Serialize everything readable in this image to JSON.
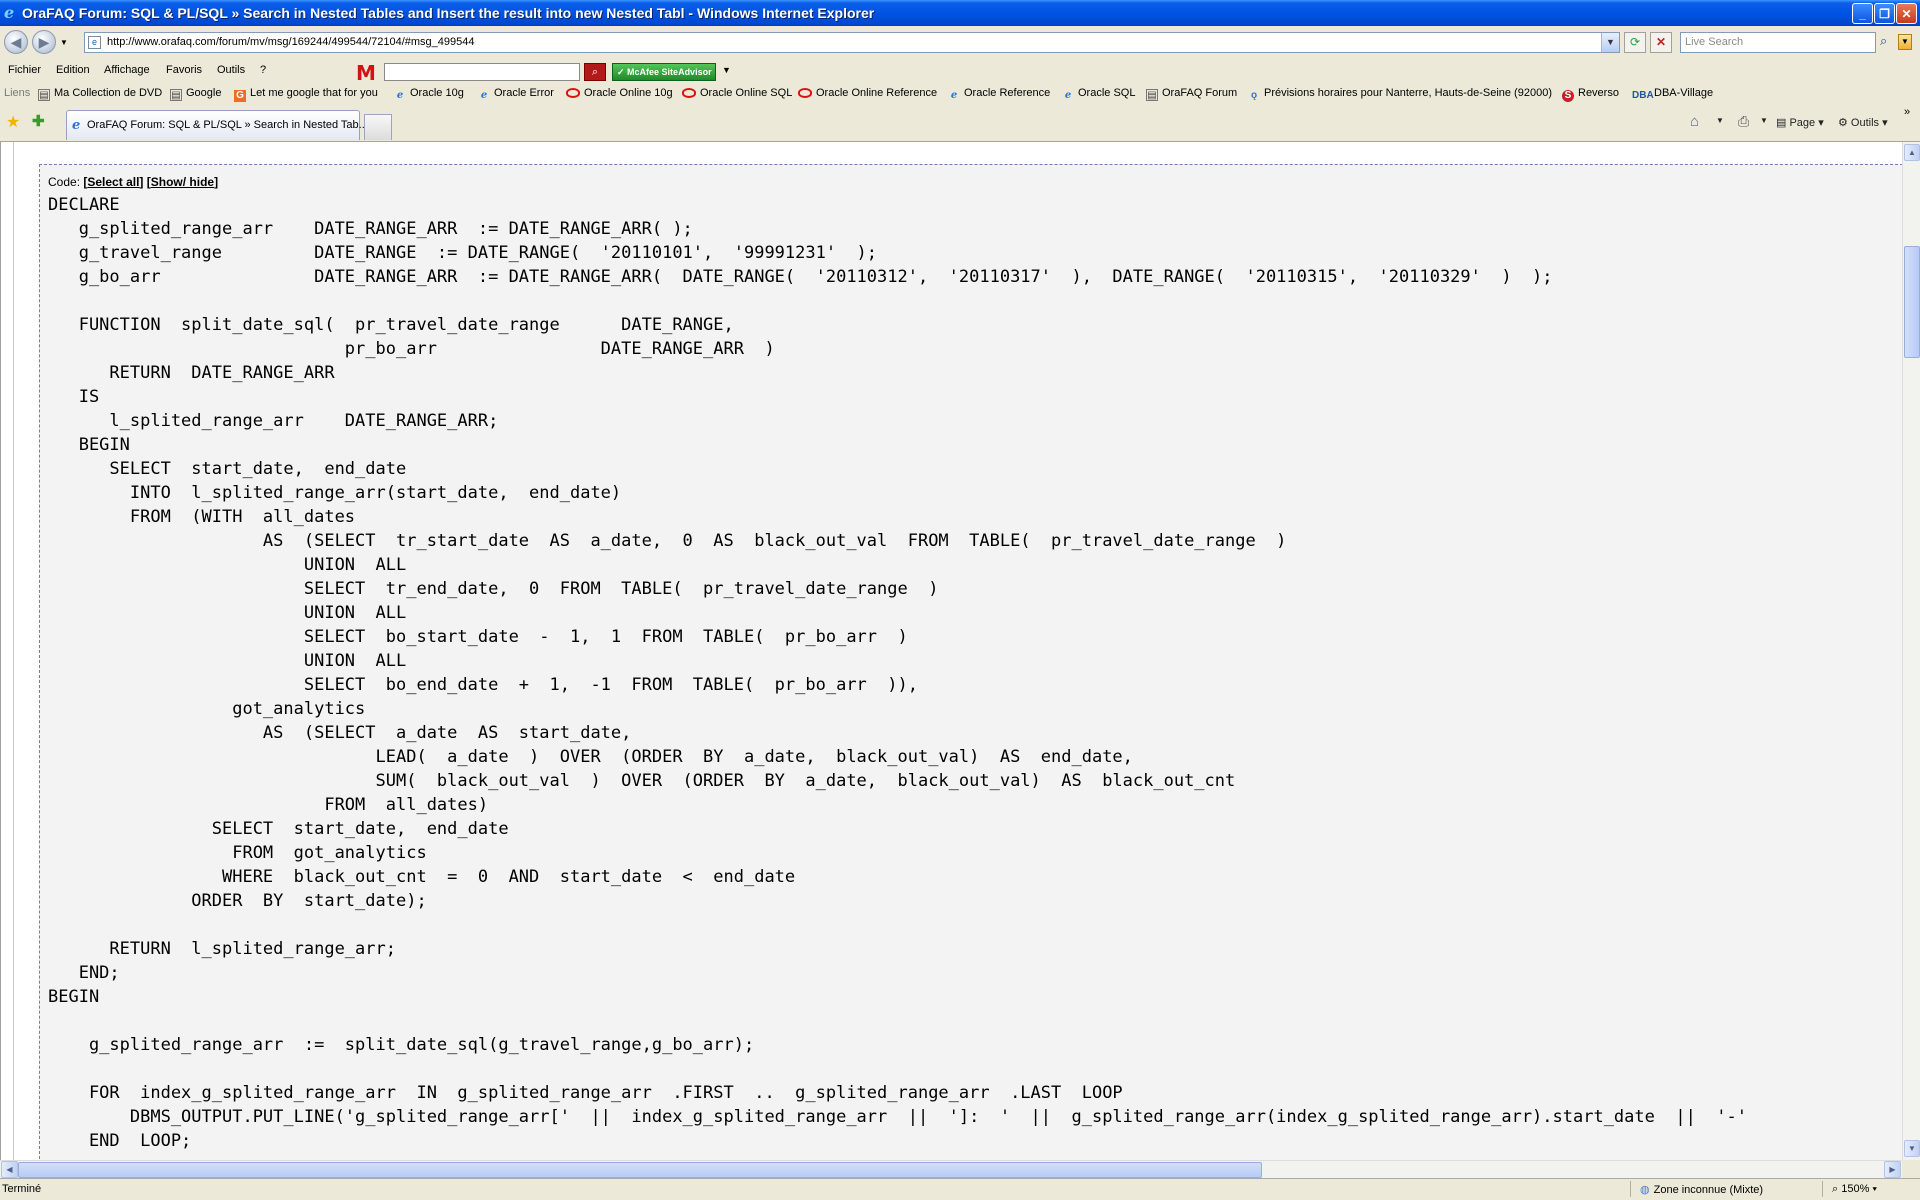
{
  "window": {
    "title": "OraFAQ Forum: SQL & PL/SQL » Search in Nested Tables and Insert the result into new Nested Tabl - Windows Internet Explorer",
    "minimize": "_",
    "restore": "❐",
    "close": "✕"
  },
  "address": {
    "url": "http://www.orafaq.com/forum/mv/msg/169244/499544/72104/#msg_499544",
    "search_placeholder": "Live Search"
  },
  "menu": {
    "items": [
      "Fichier",
      "Edition",
      "Affichage",
      "Favoris",
      "Outils",
      "?"
    ],
    "mcafee": "McAfee SiteAdvisor"
  },
  "links": {
    "label": "Liens",
    "items": [
      "Ma Collection de DVD",
      "Google",
      "Let me google that for you",
      "Oracle 10g",
      "Oracle Error",
      "Oracle Online 10g",
      "Oracle Online SQL",
      "Oracle Online Reference",
      "Oracle Reference",
      "Oracle SQL",
      "OraFAQ Forum",
      "Prévisions horaires pour Nanterre, Hauts-de-Seine (92000)",
      "Reverso",
      "DBA-Village"
    ]
  },
  "tabs": {
    "active_label": "OraFAQ Forum: SQL & PL/SQL » Search in Nested Tab...",
    "page_cmd": "Page",
    "tools_cmd": "Outils"
  },
  "code": {
    "label": "Code:",
    "select_all": "Select all",
    "show_hide": "Show/ hide",
    "lines": [
      "DECLARE",
      "   g_splited_range_arr    DATE_RANGE_ARR  := DATE_RANGE_ARR( );",
      "   g_travel_range         DATE_RANGE  := DATE_RANGE(  '20110101',  '99991231'  );",
      "   g_bo_arr               DATE_RANGE_ARR  := DATE_RANGE_ARR(  DATE_RANGE(  '20110312',  '20110317'  ),  DATE_RANGE(  '20110315',  '20110329'  )  );",
      "",
      "   FUNCTION  split_date_sql(  pr_travel_date_range      DATE_RANGE,",
      "                             pr_bo_arr                DATE_RANGE_ARR  )",
      "      RETURN  DATE_RANGE_ARR",
      "   IS",
      "      l_splited_range_arr    DATE_RANGE_ARR;",
      "   BEGIN",
      "      SELECT  start_date,  end_date",
      "        INTO  l_splited_range_arr(start_date,  end_date)",
      "        FROM  (WITH  all_dates",
      "                     AS  (SELECT  tr_start_date  AS  a_date,  0  AS  black_out_val  FROM  TABLE(  pr_travel_date_range  )",
      "                         UNION  ALL",
      "                         SELECT  tr_end_date,  0  FROM  TABLE(  pr_travel_date_range  )",
      "                         UNION  ALL",
      "                         SELECT  bo_start_date  -  1,  1  FROM  TABLE(  pr_bo_arr  )",
      "                         UNION  ALL",
      "                         SELECT  bo_end_date  +  1,  -1  FROM  TABLE(  pr_bo_arr  )),",
      "                  got_analytics",
      "                     AS  (SELECT  a_date  AS  start_date,",
      "                                LEAD(  a_date  )  OVER  (ORDER  BY  a_date,  black_out_val)  AS  end_date,",
      "                                SUM(  black_out_val  )  OVER  (ORDER  BY  a_date,  black_out_val)  AS  black_out_cnt",
      "                           FROM  all_dates)",
      "                SELECT  start_date,  end_date",
      "                  FROM  got_analytics",
      "                 WHERE  black_out_cnt  =  0  AND  start_date  <  end_date",
      "              ORDER  BY  start_date);",
      "",
      "      RETURN  l_splited_range_arr;",
      "   END;",
      "BEGIN",
      "",
      "    g_splited_range_arr  :=  split_date_sql(g_travel_range,g_bo_arr);",
      "",
      "    FOR  index_g_splited_range_arr  IN  g_splited_range_arr  .FIRST  ..  g_splited_range_arr  .LAST  LOOP",
      "        DBMS_OUTPUT.PUT_LINE('g_splited_range_arr['  ||  index_g_splited_range_arr  ||  ']:  '  ||  g_splited_range_arr(index_g_splited_range_arr).start_date  ||  '-'",
      "    END  LOOP;"
    ]
  },
  "status": {
    "text": "Terminé",
    "zone": "Zone inconnue (Mixte)",
    "zoom": "150%"
  }
}
